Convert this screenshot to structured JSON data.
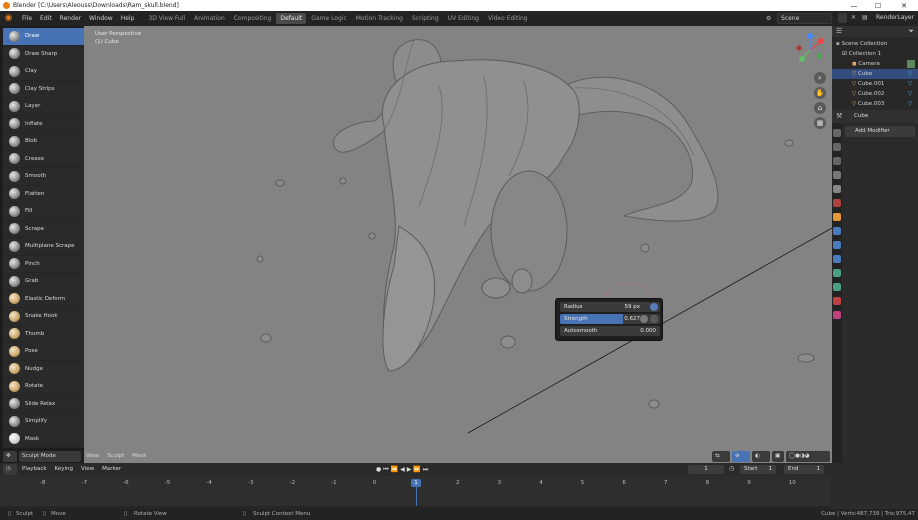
{
  "window": {
    "title": "Blender [C:\\Users\\Aleouss\\Downloads\\Ram_skull.blend]",
    "minimize": "—",
    "maximize": "☐",
    "close": "✕"
  },
  "menu": [
    "File",
    "Edit",
    "Render",
    "Window",
    "Help"
  ],
  "workspaces": [
    "3D View Full",
    "Animation",
    "Compositing",
    "Default",
    "Game Logic",
    "Motion Tracking",
    "Scripting",
    "UV Editing",
    "Video Editing"
  ],
  "active_workspace": "Default",
  "scene": "Scene",
  "view_layer": "RenderLayer",
  "tools": [
    "Draw",
    "Draw Sharp",
    "Clay",
    "Clay Strips",
    "Layer",
    "Inflate",
    "Blob",
    "Crease",
    "Smooth",
    "Flatten",
    "Fill",
    "Scrape",
    "Multiplane Scrape",
    "Pinch",
    "Grab",
    "Elastic Deform",
    "Snake Hook",
    "Thumb",
    "Pose",
    "Nudge",
    "Rotate",
    "Slide Relax",
    "Simplify",
    "Mask"
  ],
  "active_tool": "Draw",
  "viewport": {
    "view_name": "User Perspective",
    "object_name": "(1) Cube"
  },
  "brush_popup": {
    "radius_label": "Radius",
    "radius_value": "59 px",
    "strength_label": "Strength",
    "strength_value": "0.627",
    "strength_fraction": 0.627,
    "autosmooth_label": "Autosmooth",
    "autosmooth_value": "0.000"
  },
  "viewport_header": {
    "mode": "Sculpt Mode",
    "menus": [
      "View",
      "Sculpt",
      "Mask"
    ]
  },
  "outliner": {
    "rows": [
      {
        "label": "Scene Collection"
      },
      {
        "label": "Collection 1"
      },
      {
        "label": "Camera"
      },
      {
        "label": "Cube",
        "selected": true
      },
      {
        "label": "Cube.001"
      },
      {
        "label": "Cube.002"
      },
      {
        "label": "Cube.003"
      }
    ]
  },
  "properties": {
    "object_name": "Cube",
    "add_modifier": "Add Modifier"
  },
  "timeline": {
    "menus": [
      "Playback",
      "Keying",
      "View",
      "Marker"
    ],
    "current_frame": "1",
    "start_label": "Start",
    "start_value": "1",
    "end_label": "End",
    "end_value": "1",
    "ruler": [
      "-8",
      "-7",
      "-6",
      "-5",
      "-4",
      "-3",
      "-2",
      "-1",
      "0",
      "1",
      "2",
      "3",
      "4",
      "5",
      "6",
      "7",
      "8",
      "9",
      "10"
    ]
  },
  "statusbar": {
    "sculpt": "Sculpt",
    "move": "Move",
    "rotate_view": "Rotate View",
    "context_menu": "Sculpt Context Menu",
    "stats": "Cube | Verts:487,739 | Tris:975,47"
  }
}
